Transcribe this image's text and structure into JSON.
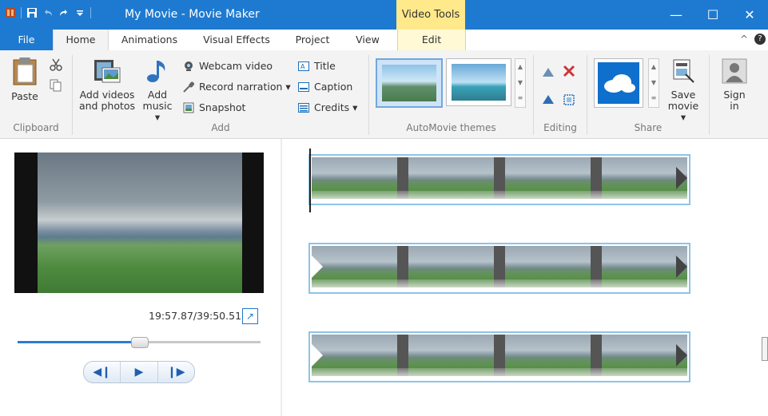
{
  "window": {
    "title": "My Movie - Movie Maker",
    "context_tab": "Video Tools",
    "controls": {
      "minimize": "—",
      "maximize": "☐",
      "close": "✕"
    }
  },
  "tabs": {
    "file": "File",
    "home": "Home",
    "animations": "Animations",
    "visual_effects": "Visual Effects",
    "project": "Project",
    "view": "View",
    "edit": "Edit"
  },
  "ribbon": {
    "clipboard": {
      "label": "Clipboard",
      "paste": "Paste"
    },
    "add": {
      "label": "Add",
      "add_videos_line1": "Add videos",
      "add_videos_line2": "and photos",
      "add_music_line1": "Add",
      "add_music_line2": "music ▾",
      "webcam_video": "Webcam video",
      "record_narration": "Record narration ▾",
      "snapshot": "Snapshot",
      "title": "Title",
      "caption": "Caption",
      "credits": "Credits ▾"
    },
    "themes": {
      "label": "AutoMovie themes"
    },
    "editing": {
      "label": "Editing"
    },
    "share": {
      "label": "Share",
      "save_movie_line1": "Save",
      "save_movie_line2": "movie ▾"
    },
    "signin": {
      "line1": "Sign",
      "line2": "in"
    }
  },
  "preview": {
    "time": "19:57.87/39:50.51",
    "seek_progress": 0.5
  }
}
